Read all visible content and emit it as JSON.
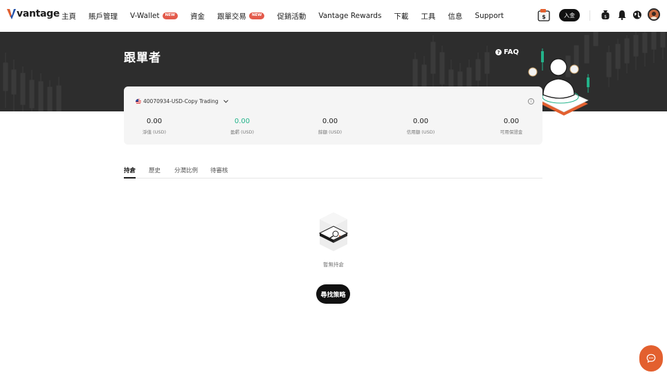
{
  "brand": {
    "name": "vantage",
    "accent": "#e3602f",
    "logo_blue": "#1f4fa8"
  },
  "nav": {
    "items": [
      {
        "label": "主頁"
      },
      {
        "label": "賬戶管理"
      },
      {
        "label": "V-Wallet",
        "badge": "NEW"
      },
      {
        "label": "資金"
      },
      {
        "label": "跟單交易",
        "badge": "NEW"
      },
      {
        "label": "促銷活動"
      },
      {
        "label": "Vantage Rewards"
      },
      {
        "label": "下載"
      },
      {
        "label": "工具"
      },
      {
        "label": "信息"
      },
      {
        "label": "Support"
      }
    ],
    "deposit_label": "入金",
    "icons": [
      "wallet-icon",
      "moneybag-icon",
      "bell-icon",
      "globe-icon"
    ]
  },
  "banner": {
    "title": "跟單者",
    "faq_label": "FAQ"
  },
  "account": {
    "selector": "40070934-USD-Copy Trading",
    "stats": [
      {
        "value": "0.00",
        "label": "淨值 (USD)",
        "color": "#1b1b1b"
      },
      {
        "value": "0.00",
        "label": "盈虧 (USD)",
        "color": "#23b38a"
      },
      {
        "value": "0.00",
        "label": "餘額 (USD)",
        "color": "#1b1b1b"
      },
      {
        "value": "0.00",
        "label": "信用額 (USD)",
        "color": "#1b1b1b"
      },
      {
        "value": "0.00",
        "label": "可用保證金",
        "color": "#1b1b1b"
      }
    ]
  },
  "tabs": [
    {
      "label": "持倉",
      "active": true
    },
    {
      "label": "歷史",
      "active": false
    },
    {
      "label": "分潤比例",
      "active": false
    },
    {
      "label": "待審核",
      "active": false
    }
  ],
  "empty_state": {
    "message": "暫無持倉",
    "button_label": "尋找策略"
  }
}
